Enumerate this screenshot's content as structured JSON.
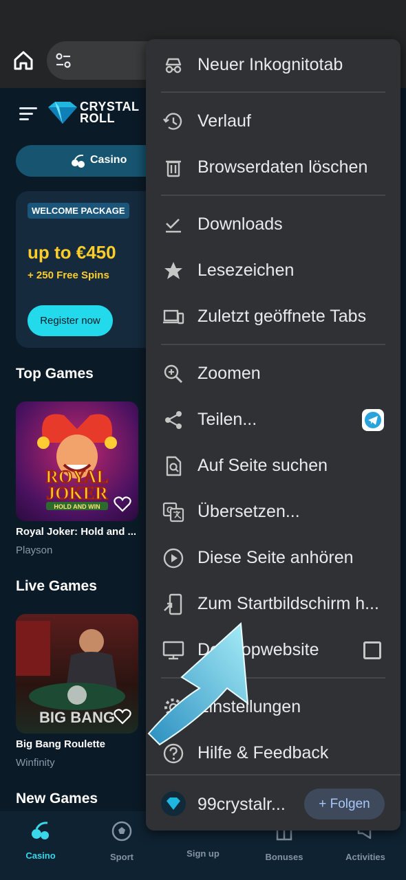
{
  "site": {
    "brand": "CRYSTAL\nROLL",
    "brand_line1": "CRYSTAL",
    "brand_line2": "ROLL",
    "casino_tab": "Casino",
    "promo": {
      "badge": "WELCOME PACKAGE",
      "amount": "up to €450",
      "spins": "+ 250 Free Spins",
      "cta": "Register now"
    },
    "sections": {
      "top_games": "Top Games",
      "live_games": "Live Games",
      "new_games": "New Games"
    },
    "games": [
      {
        "name": "Royal Joker: Hold and ...",
        "provider": "Playson",
        "art_line1": "ROYAL",
        "art_line2": "JOKER",
        "art_line3": "HOLD AND WIN"
      },
      {
        "name": "Big Bang Roulette",
        "provider": "Winfinity",
        "art_line1": "BIG BANG"
      }
    ]
  },
  "bottom_nav": [
    {
      "label": "Casino",
      "icon": "cherries-icon",
      "active": true
    },
    {
      "label": "Sport",
      "icon": "soccer-ball-icon"
    },
    {
      "label": "Sign up",
      "icon": "signup-icon"
    },
    {
      "label": "Bonuses",
      "icon": "gift-icon"
    },
    {
      "label": "Activities",
      "icon": "megaphone-icon"
    }
  ],
  "menu": {
    "items": [
      {
        "label": "Neuer Inkognitotab",
        "icon": "incognito-icon"
      },
      {
        "label": "Verlauf",
        "icon": "history-icon"
      },
      {
        "label": "Browserdaten löschen",
        "icon": "trash-icon"
      },
      {
        "label": "Downloads",
        "icon": "download-check-icon"
      },
      {
        "label": "Lesezeichen",
        "icon": "star-icon"
      },
      {
        "label": "Zuletzt geöffnete Tabs",
        "icon": "devices-icon"
      },
      {
        "label": "Zoomen",
        "icon": "zoom-in-icon"
      },
      {
        "label": "Teilen...",
        "icon": "share-icon"
      },
      {
        "label": "Auf Seite suchen",
        "icon": "find-in-page-icon"
      },
      {
        "label": "Übersetzen...",
        "icon": "translate-icon"
      },
      {
        "label": "Diese Seite anhören",
        "icon": "play-circle-icon"
      },
      {
        "label": "Zum Startbildschirm h...",
        "icon": "add-to-home-icon"
      },
      {
        "label": "Desktopwebsite",
        "icon": "desktop-icon"
      },
      {
        "label": "Einstellungen",
        "icon": "settings-gear-icon"
      },
      {
        "label": "Hilfe & Feedback",
        "icon": "help-icon"
      }
    ],
    "visible_labels": {
      "desktop": "Desktopwebsite",
      "settings": "Einstellungen"
    },
    "site_name": "99crystalr...",
    "follow_label": "+ Folgen"
  },
  "colors": {
    "accent": "#23d9ec",
    "promo_yellow": "#ffcd29",
    "menu_bg": "#303134",
    "arrow": "#5ec6e6"
  }
}
